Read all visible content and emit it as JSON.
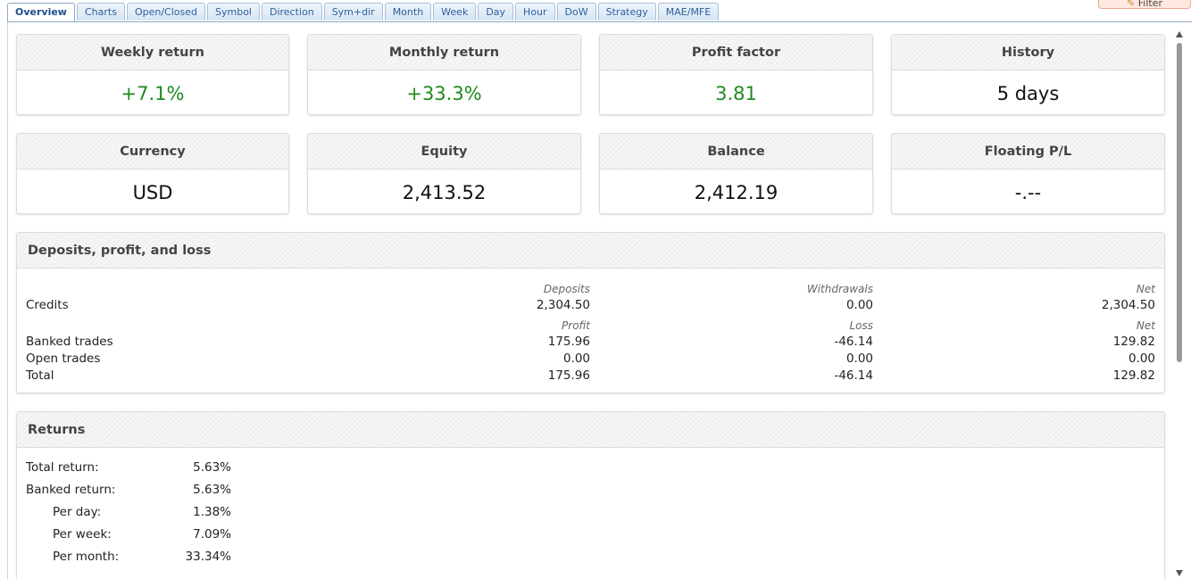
{
  "tabs": [
    {
      "label": "Overview",
      "active": true
    },
    {
      "label": "Charts"
    },
    {
      "label": "Open/Closed"
    },
    {
      "label": "Symbol"
    },
    {
      "label": "Direction"
    },
    {
      "label": "Sym+dir"
    },
    {
      "label": "Month"
    },
    {
      "label": "Week"
    },
    {
      "label": "Day"
    },
    {
      "label": "Hour"
    },
    {
      "label": "DoW"
    },
    {
      "label": "Strategy"
    },
    {
      "label": "MAE/MFE"
    }
  ],
  "filter_button": {
    "label": "Filter",
    "icon": "pencil-icon"
  },
  "stats_row1": [
    {
      "title": "Weekly return",
      "value": "+7.1%",
      "positive": true
    },
    {
      "title": "Monthly return",
      "value": "+33.3%",
      "positive": true
    },
    {
      "title": "Profit factor",
      "value": "3.81",
      "positive": true
    },
    {
      "title": "History",
      "value": "5 days",
      "positive": false
    }
  ],
  "stats_row2": [
    {
      "title": "Currency",
      "value": "USD"
    },
    {
      "title": "Equity",
      "value": "2,413.52"
    },
    {
      "title": "Balance",
      "value": "2,412.19"
    },
    {
      "title": "Floating P/L",
      "value": "-.--"
    }
  ],
  "deposits": {
    "title": "Deposits, profit, and loss",
    "credits_header": {
      "c1": "Deposits",
      "c2": "Withdrawals",
      "c3": "Net"
    },
    "credits": {
      "label": "Credits",
      "c1": "2,304.50",
      "c2": "0.00",
      "c3": "2,304.50"
    },
    "trades_header": {
      "c1": "Profit",
      "c2": "Loss",
      "c3": "Net"
    },
    "banked": {
      "label": "Banked trades",
      "c1": "175.96",
      "c2": "-46.14",
      "c3": "129.82"
    },
    "open": {
      "label": "Open trades",
      "c1": "0.00",
      "c2": "0.00",
      "c3": "0.00"
    },
    "total": {
      "label": "Total",
      "c1": "175.96",
      "c2": "-46.14",
      "c3": "129.82"
    }
  },
  "returns": {
    "title": "Returns",
    "rows": [
      {
        "label": "Total return:",
        "value": "5.63%"
      },
      {
        "label": "Banked return:",
        "value": "5.63%"
      },
      {
        "label": "Per day:",
        "value": "1.38%"
      },
      {
        "label": "Per week:",
        "value": "7.09%"
      },
      {
        "label": "Per month:",
        "value": "33.34%"
      }
    ]
  },
  "colors": {
    "positive": "#1d8a1d",
    "tab_text": "#2b5f9e"
  }
}
